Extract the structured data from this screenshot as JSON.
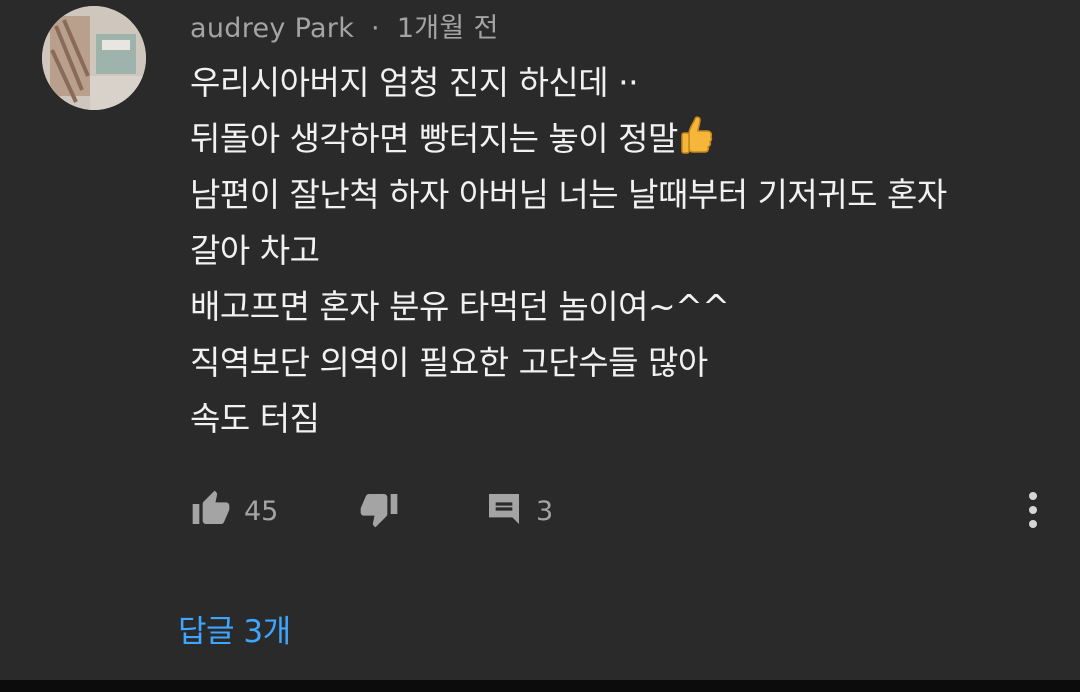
{
  "comment": {
    "author": "audrey Park",
    "separator": "·",
    "time": "1개월 전",
    "lines": [
      "우리시아버지 엄청  진지 하신데 ··",
      "뒤돌아  생각하면  빵터지는  놓이  정말",
      "남편이  잘난척 하자  아버님  너는 날때부터  기저귀도 혼자",
      "갈아 차고",
      "배고프면  혼자 분유 타먹던 놈이여~^^",
      "직역보단 의역이  필요한  고단수들  많아",
      "속도  터짐"
    ],
    "emoji_icon": "thumbs-up-emoji-icon"
  },
  "actions": {
    "like_count": "45",
    "reply_count": "3",
    "like_icon": "thumbs-up-icon",
    "dislike_icon": "thumbs-down-icon",
    "reply_icon": "comment-icon",
    "more_icon": "more-vertical-icon"
  },
  "replies": {
    "label": "답글 3개"
  },
  "colors": {
    "background": "#2a2a2a",
    "text": "#f1f1f1",
    "secondary": "#a4a4a4",
    "link": "#3ea6ff"
  }
}
